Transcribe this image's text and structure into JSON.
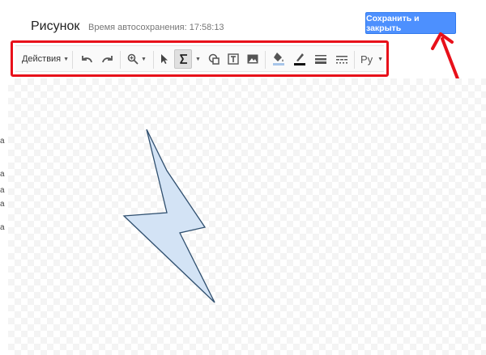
{
  "dialog": {
    "title": "Рисунок",
    "autosave": "Время автосохранения: 17:58:13",
    "save_button": "Сохранить и закрыть"
  },
  "toolbar": {
    "actions_label": "Действия",
    "font_label": "Ру",
    "items": [
      {
        "icon": "undo-icon"
      },
      {
        "icon": "redo-icon"
      },
      {
        "icon": "zoom-icon"
      },
      {
        "icon": "select-arrow-icon"
      },
      {
        "icon": "line-tool-icon"
      },
      {
        "icon": "shape-icon"
      },
      {
        "icon": "text-box-icon"
      },
      {
        "icon": "image-icon"
      },
      {
        "icon": "fill-color-icon"
      },
      {
        "icon": "line-color-icon"
      },
      {
        "icon": "line-weight-icon"
      },
      {
        "icon": "line-dash-icon"
      }
    ]
  },
  "colors": {
    "highlight_border": "#e8101a",
    "save_button": "#4d90fe",
    "shape_fill": "#d3e3f5",
    "shape_stroke": "#2f4f6f"
  },
  "left_edge_text": [
    "а",
    "а",
    "а",
    "а",
    "а"
  ]
}
